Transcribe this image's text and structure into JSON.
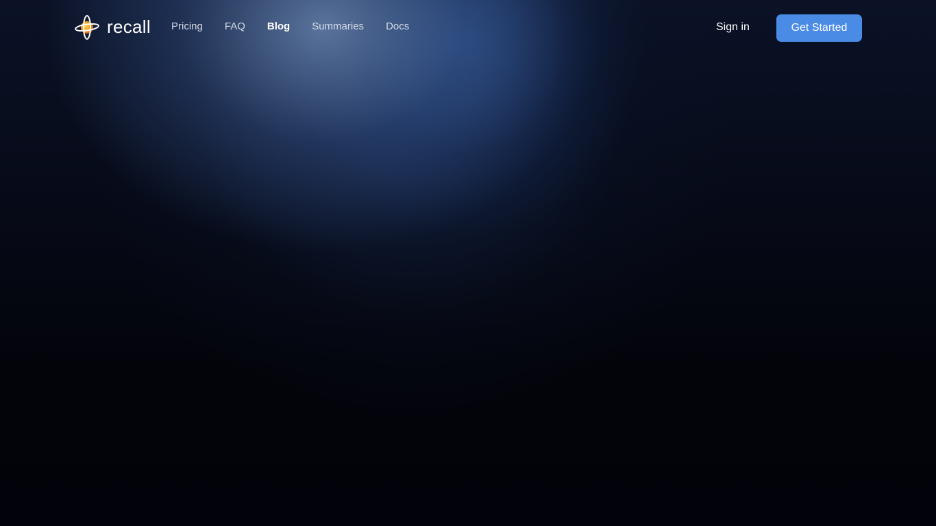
{
  "brand": {
    "name": "recall",
    "logo_icon": "recall-logo-icon",
    "logo_colors": [
      "#f5a623",
      "#e8741c",
      "#ffffff"
    ]
  },
  "nav": {
    "links": [
      {
        "label": "Pricing",
        "active": false
      },
      {
        "label": "FAQ",
        "active": false
      },
      {
        "label": "Blog",
        "active": true
      },
      {
        "label": "Summaries",
        "active": false
      },
      {
        "label": "Docs",
        "active": false
      }
    ]
  },
  "auth": {
    "sign_in_label": "Sign in",
    "get_started_label": "Get Started",
    "accent_color": "#4a8be6"
  }
}
